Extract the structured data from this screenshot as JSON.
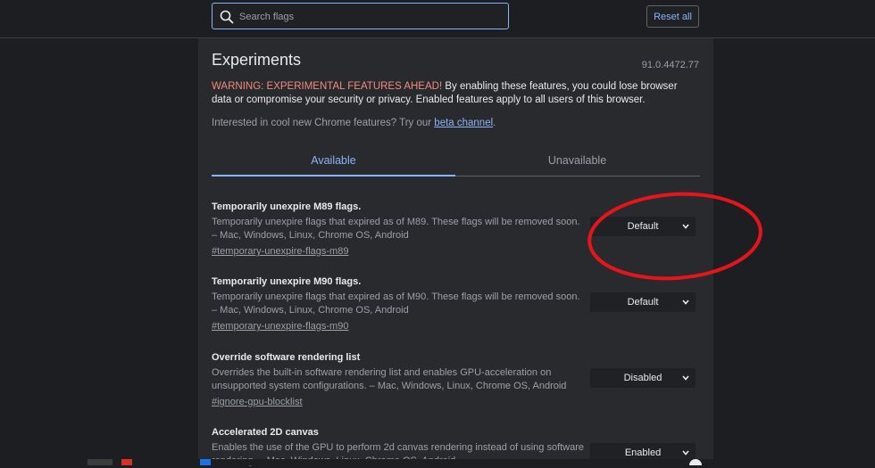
{
  "header": {
    "search_placeholder": "Search flags",
    "reset_label": "Reset all"
  },
  "main": {
    "title": "Experiments",
    "version": "91.0.4472.77",
    "warning_label": "WARNING: EXPERIMENTAL FEATURES AHEAD!",
    "warning_text": " By enabling these features, you could lose browser data or compromise your security or privacy. Enabled features apply to all users of this browser.",
    "interest_text": "Interested in cool new Chrome features? Try our ",
    "beta_link": "beta channel",
    "interest_end": ".",
    "tabs": [
      {
        "label": "Available"
      },
      {
        "label": "Unavailable"
      }
    ]
  },
  "flags": [
    {
      "name": "Temporarily unexpire M89 flags.",
      "description": "Temporarily unexpire flags that expired as of M89. These flags will be removed soon. – Mac, Windows, Linux, Chrome OS, Android",
      "link": "#temporary-unexpire-flags-m89",
      "value": "Default"
    },
    {
      "name": "Temporarily unexpire M90 flags.",
      "description": "Temporarily unexpire flags that expired as of M90. These flags will be removed soon. – Mac, Windows, Linux, Chrome OS, Android",
      "link": "#temporary-unexpire-flags-m90",
      "value": "Default"
    },
    {
      "name": "Override software rendering list",
      "description": "Overrides the built-in software rendering list and enables GPU-acceleration on unsupported system configurations. – Mac, Windows, Linux, Chrome OS, Android",
      "link": "#ignore-gpu-blocklist",
      "value": "Disabled"
    },
    {
      "name": "Accelerated 2D canvas",
      "description": "Enables the use of the GPU to perform 2d canvas rendering instead of using software rendering. – Mac, Windows, Linux, Chrome OS, Android",
      "link": "",
      "value": "Enabled"
    }
  ],
  "icons": {
    "search": "search-icon",
    "chevron": "chevron-down-icon"
  },
  "colors": {
    "accent": "#8ab4f8",
    "warning": "#f28b82",
    "annotation": "#e8141c",
    "background": "#1d1e21",
    "panel": "#292a2d"
  }
}
